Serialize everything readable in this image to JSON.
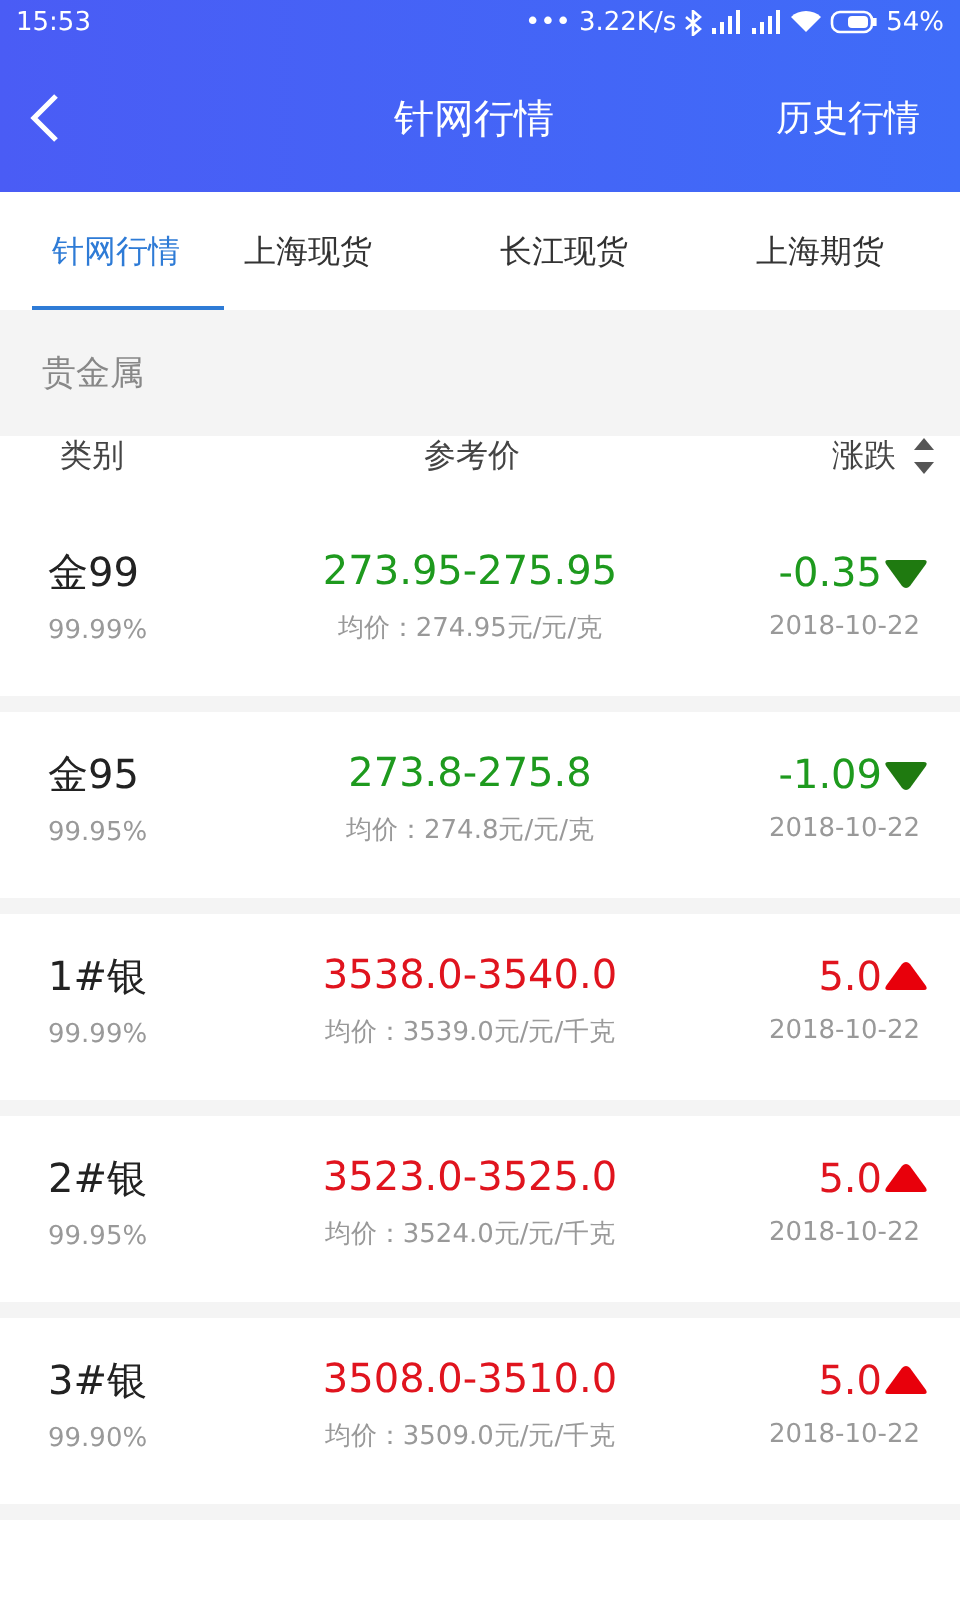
{
  "status_bar": {
    "time": "15:53",
    "dots": "•••",
    "speed": "3.22K/s",
    "battery": "54%"
  },
  "header": {
    "title": "针网行情",
    "action": "历史行情"
  },
  "tabs": [
    {
      "label": "针网行情",
      "selected": true
    },
    {
      "label": "上海现货",
      "selected": false
    },
    {
      "label": "长江现货",
      "selected": false
    },
    {
      "label": "上海期货",
      "selected": false
    }
  ],
  "section": "贵金属",
  "columns": [
    "类别",
    "参考价",
    "涨跌"
  ],
  "rows": [
    {
      "name": "金99",
      "purity": "99.99%",
      "price": "273.95-275.95",
      "average": "均价：274.95元/元/克",
      "change": "-0.35",
      "kind": "down",
      "date": "2018-10-22"
    },
    {
      "name": "金95",
      "purity": "99.95%",
      "price": "273.8-275.8",
      "average": "均价：274.8元/元/克",
      "change": "-1.09",
      "kind": "down",
      "date": "2018-10-22"
    },
    {
      "name": "1#银",
      "purity": "99.99%",
      "price": "3538.0-3540.0",
      "average": "均价：3539.0元/元/千克",
      "change": "5.0",
      "kind": "up",
      "date": "2018-10-22"
    },
    {
      "name": "2#银",
      "purity": "99.95%",
      "price": "3523.0-3525.0",
      "average": "均价：3524.0元/元/千克",
      "change": "5.0",
      "kind": "up",
      "date": "2018-10-22"
    },
    {
      "name": "3#银",
      "purity": "99.90%",
      "price": "3508.0-3510.0",
      "average": "均价：3509.0元/元/千克",
      "change": "5.0",
      "kind": "up",
      "date": "2018-10-22"
    }
  ]
}
